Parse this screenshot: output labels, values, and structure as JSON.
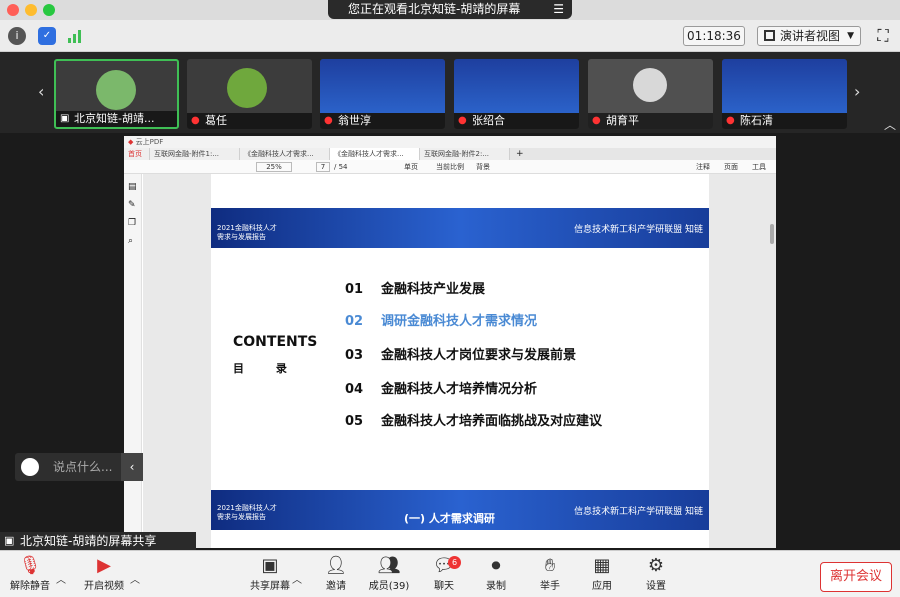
{
  "window": {
    "title": "您正在观看北京知链-胡靖的屏幕",
    "menu_icon": "list-icon",
    "colors": {
      "close": "#ff5f57",
      "minimize": "#febc2e",
      "zoom": "#28c840"
    }
  },
  "topbar": {
    "timer": "01:18:36",
    "view_label": "演讲者视图"
  },
  "participants": [
    {
      "name": "北京知链-胡靖..."
    },
    {
      "name": "葛任"
    },
    {
      "name": "翁世淳"
    },
    {
      "name": "张绍合"
    },
    {
      "name": "胡育平"
    },
    {
      "name": "陈石清"
    }
  ],
  "pdf": {
    "app_title": "云上PDF",
    "tabs": [
      "首页",
      "互联网金融-附件1:...",
      "《金融科技人才需求...",
      "《金融科技人才需求...",
      "互联网金融-附件2:..."
    ],
    "toolbar": {
      "zoom": "25%",
      "page": "7",
      "total": "/ 54",
      "single": "单页",
      "actual": "当前比例",
      "bg": "背景",
      "notes": "注释",
      "pages_label": "页面",
      "tools": "工具"
    },
    "slide": {
      "report_line1": "2021金融科技人才",
      "report_line2": "需求与发展报告",
      "logo_text": "信息技术新工科产学研联盟",
      "brand": "知链",
      "contents_heading": "CONTENTS",
      "mulu": "目 录",
      "toc": [
        {
          "num": "01",
          "text": "金融科技产业发展"
        },
        {
          "num": "02",
          "text": "调研金融科技人才需求情况"
        },
        {
          "num": "03",
          "text": "金融科技人才岗位要求与发展前景"
        },
        {
          "num": "04",
          "text": "金融科技人才培养情况分析"
        },
        {
          "num": "05",
          "text": "金融科技人才培养面临挑战及对应建议"
        }
      ],
      "next_title": "(一) 人才需求调研"
    }
  },
  "chat": {
    "placeholder": "说点什么..."
  },
  "share_label": "北京知链-胡靖的屏幕共享",
  "bottom": {
    "mute": "解除静音",
    "video": "开启视频",
    "share": "共享屏幕",
    "invite": "邀请",
    "members": "成员(39)",
    "chat": "聊天",
    "chat_badge": "6",
    "record": "录制",
    "hand": "举手",
    "apps": "应用",
    "settings": "设置",
    "leave": "离开会议"
  }
}
